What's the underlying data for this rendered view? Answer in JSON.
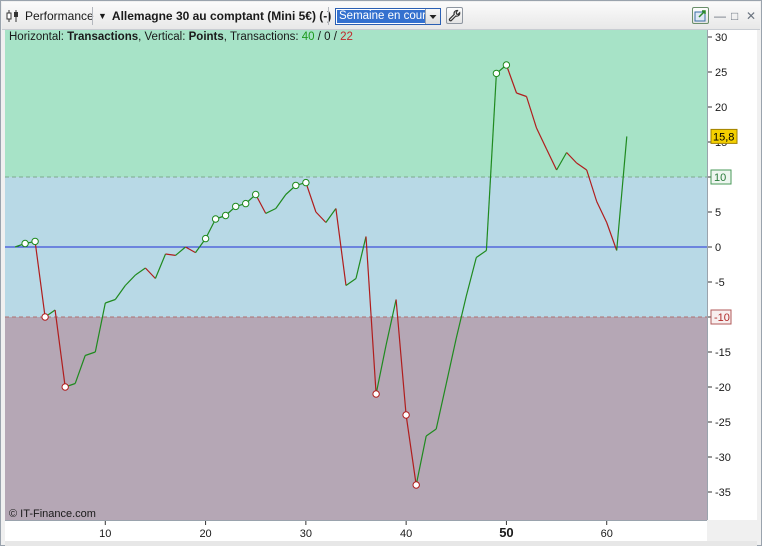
{
  "toolbar": {
    "performance_label": "Performance",
    "instrument_label": "Allemagne 30 au comptant (Mini 5€) (-)",
    "period_select": "Semaine en cours"
  },
  "info": {
    "h_prefix": "Horizontal: ",
    "h_value": "Transactions",
    "v_prefix": ", Vertical: ",
    "v_value": "Points",
    "t_prefix": ", Transactions: ",
    "winners": "40",
    "slash1": " / ",
    "neutral": "0",
    "slash2": " / ",
    "losers": "22"
  },
  "copyright": "© IT-Finance.com",
  "colors": {
    "zone_top": "#a7e3c7",
    "zone_middle": "#b8d9e6",
    "zone_bottom": "#b5a7b5",
    "gain_line": "#1f8a1f",
    "loss_line": "#b01d1d",
    "zero_line": "#1f2fd6",
    "last_value_badge": "#f4d000"
  },
  "chart_data": {
    "type": "line",
    "x": [
      1,
      2,
      3,
      4,
      5,
      6,
      7,
      8,
      9,
      10,
      11,
      12,
      13,
      14,
      15,
      16,
      17,
      18,
      19,
      20,
      21,
      22,
      23,
      24,
      25,
      26,
      27,
      28,
      29,
      30,
      31,
      32,
      33,
      34,
      35,
      36,
      37,
      38,
      39,
      40,
      41,
      42,
      43,
      44,
      45,
      46,
      47,
      48,
      49,
      50,
      51,
      52,
      53,
      54,
      55,
      56,
      57,
      58,
      59,
      60,
      61,
      62
    ],
    "values": [
      0,
      0.5,
      0.8,
      -10,
      -9,
      -20,
      -19.5,
      -15.5,
      -15,
      -8,
      -7.5,
      -5.5,
      -4,
      -3,
      -4.5,
      -1,
      -1.2,
      0,
      -0.8,
      1.2,
      4,
      4.5,
      5.8,
      6.2,
      7.5,
      4.8,
      5.5,
      7.5,
      8.8,
      9.2,
      5,
      3.5,
      5.5,
      -5.5,
      -4.5,
      1.5,
      -21,
      -14,
      -7.5,
      -24,
      -34,
      -27,
      -26,
      -19.5,
      -13,
      -7,
      -1.5,
      -0.5,
      24.8,
      26,
      22,
      21.5,
      17,
      14,
      11,
      13.5,
      12,
      11,
      6.5,
      3.5,
      -0.5,
      15.8
    ],
    "markers": [
      {
        "x": 2,
        "y": 0.5,
        "kind": "gain"
      },
      {
        "x": 3,
        "y": 0.8,
        "kind": "gain"
      },
      {
        "x": 4,
        "y": -10,
        "kind": "loss"
      },
      {
        "x": 6,
        "y": -20,
        "kind": "loss"
      },
      {
        "x": 20,
        "y": 1.2,
        "kind": "gain"
      },
      {
        "x": 21,
        "y": 4,
        "kind": "gain"
      },
      {
        "x": 22,
        "y": 4.5,
        "kind": "gain"
      },
      {
        "x": 23,
        "y": 5.8,
        "kind": "gain"
      },
      {
        "x": 24,
        "y": 6.2,
        "kind": "gain"
      },
      {
        "x": 25,
        "y": 7.5,
        "kind": "gain"
      },
      {
        "x": 29,
        "y": 8.8,
        "kind": "gain"
      },
      {
        "x": 30,
        "y": 9.2,
        "kind": "gain"
      },
      {
        "x": 37,
        "y": -21,
        "kind": "loss"
      },
      {
        "x": 40,
        "y": -24,
        "kind": "loss"
      },
      {
        "x": 41,
        "y": -34,
        "kind": "loss"
      },
      {
        "x": 49,
        "y": 24.8,
        "kind": "gain"
      },
      {
        "x": 50,
        "y": 26,
        "kind": "gain"
      }
    ],
    "xlabel": "Transactions",
    "ylabel": "Points",
    "xlim": [
      0,
      70
    ],
    "ylim": [
      -39,
      31
    ],
    "yticks": [
      30,
      25,
      20,
      15,
      10,
      5,
      0,
      -5,
      -10,
      -15,
      -20,
      -25,
      -30,
      -35
    ],
    "xticks": [
      10,
      20,
      30,
      40,
      50,
      60
    ],
    "xtick_bold": 50,
    "zones": {
      "upper_threshold": 10,
      "lower_threshold": -10
    },
    "threshold_labels": [
      "10",
      "-10"
    ],
    "last_value": "15,8",
    "grid": false
  }
}
